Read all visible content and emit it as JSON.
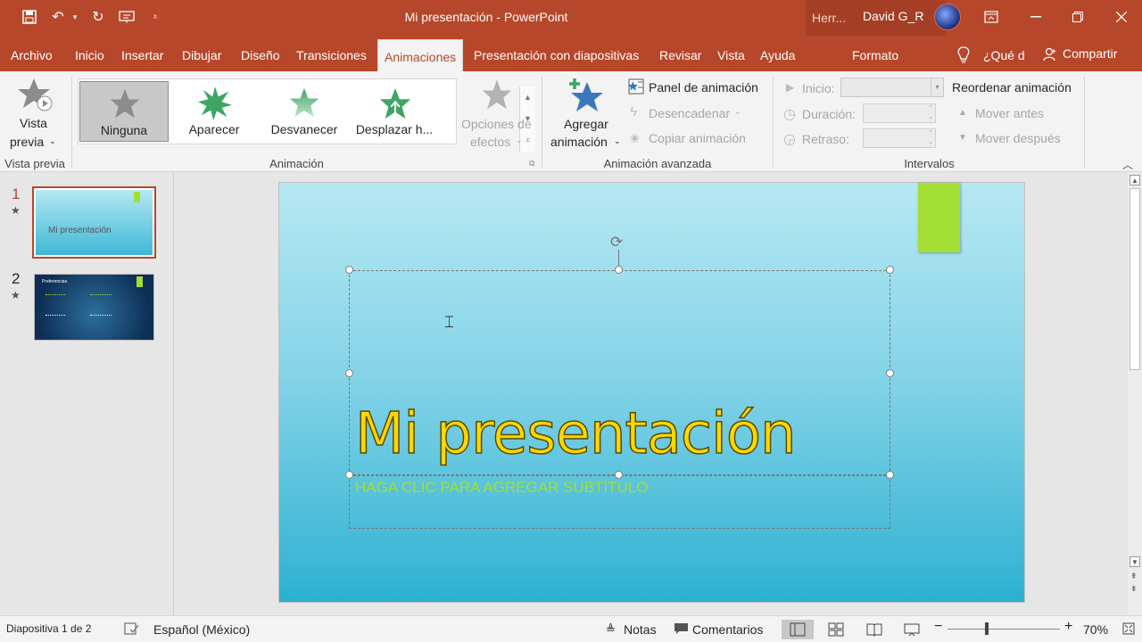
{
  "window": {
    "title": "Mi presentación  -  PowerPoint",
    "contextual_label": "Herr...",
    "user_name": "David G_R"
  },
  "tabs": [
    {
      "label": "Archivo"
    },
    {
      "label": "Inicio"
    },
    {
      "label": "Insertar"
    },
    {
      "label": "Dibujar"
    },
    {
      "label": "Diseño"
    },
    {
      "label": "Transiciones"
    },
    {
      "label": "Animaciones",
      "active": true
    },
    {
      "label": "Presentación con diapositivas"
    },
    {
      "label": "Revisar"
    },
    {
      "label": "Vista"
    },
    {
      "label": "Ayuda"
    },
    {
      "label": "Formato"
    }
  ],
  "tell_me": "¿Qué d",
  "share": "Compartir",
  "ribbon": {
    "preview": {
      "label_line1": "Vista",
      "label_line2": "previa",
      "group": "Vista previa"
    },
    "animation_gallery": {
      "items": [
        {
          "label": "Ninguna",
          "selected": true
        },
        {
          "label": "Aparecer"
        },
        {
          "label": "Desvanecer"
        },
        {
          "label": "Desplazar h..."
        }
      ],
      "effect_options_line1": "Opciones de",
      "effect_options_line2": "efectos",
      "group": "Animación"
    },
    "advanced": {
      "add_line1": "Agregar",
      "add_line2": "animación",
      "panel": "Panel de animación",
      "trigger": "Desencadenar",
      "copy": "Copiar animación",
      "group": "Animación avanzada"
    },
    "timing": {
      "start": "Inicio:",
      "duration": "Duración:",
      "delay": "Retraso:",
      "reorder": "Reordenar animación",
      "move_earlier": "Mover antes",
      "move_later": "Mover después",
      "group": "Intervalos"
    }
  },
  "thumbnails": [
    {
      "number": "1",
      "title": "Mi presentación"
    },
    {
      "number": "2",
      "title": "Preferencias"
    }
  ],
  "slide": {
    "title": "Mi presentación",
    "subtitle_placeholder": "HAGA CLIC PARA AGREGAR SUBTÍTULO"
  },
  "status": {
    "slide_info": "Diapositiva 1 de 2",
    "language": "Español (México)",
    "notes": "Notas",
    "comments": "Comentarios",
    "zoom": "70%"
  },
  "colors": {
    "accent": "#b7472a",
    "title_text": "#ffd800",
    "subtitle_text": "#a3de35",
    "green_shape": "#a3de35"
  }
}
